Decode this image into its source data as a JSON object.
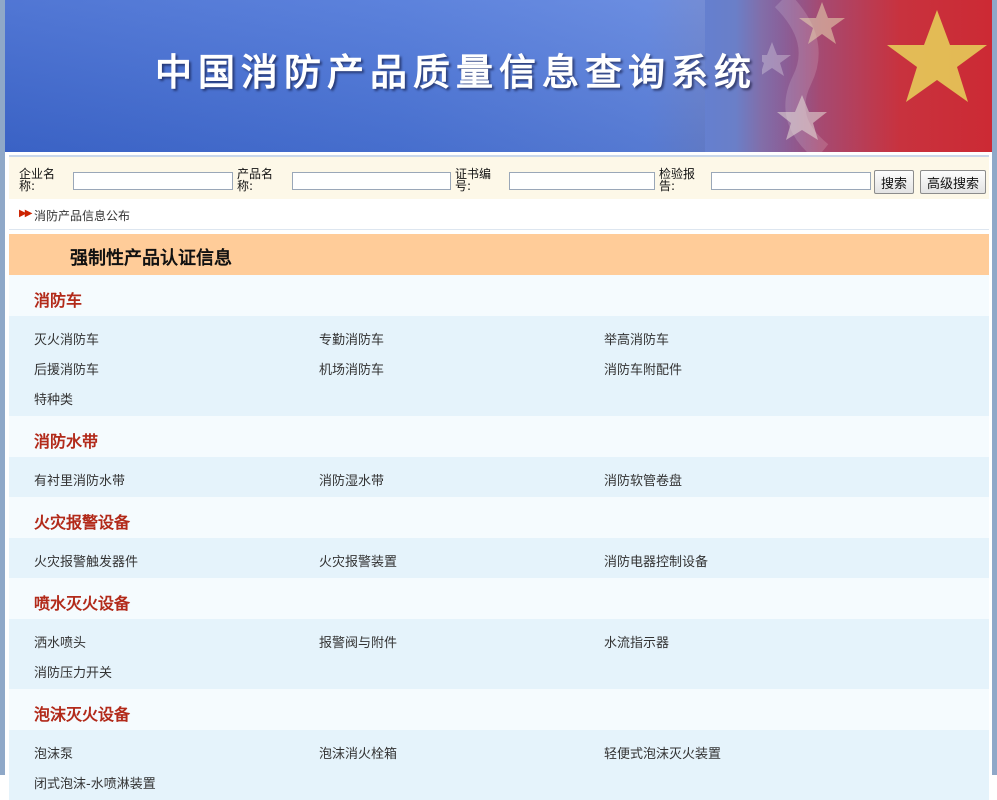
{
  "banner": {
    "title": "中国消防产品质量信息查询系统"
  },
  "search": {
    "company_label": "企业名称:",
    "product_label": "产品名称:",
    "cert_label": "证书编号:",
    "report_label": "检验报告:",
    "company_value": "",
    "product_value": "",
    "cert_value": "",
    "report_value": "",
    "search_button": "搜索",
    "advanced_button": "高级搜索"
  },
  "breadcrumb": {
    "text": "消防产品信息公布"
  },
  "section": {
    "title": "强制性产品认证信息"
  },
  "categories": [
    {
      "title": "消防车",
      "items": [
        "灭火消防车",
        "专勤消防车",
        "举高消防车",
        "后援消防车",
        "机场消防车",
        "消防车附配件",
        "特种类"
      ]
    },
    {
      "title": "消防水带",
      "items": [
        "有衬里消防水带",
        "消防湿水带",
        "消防软管卷盘"
      ]
    },
    {
      "title": "火灾报警设备",
      "items": [
        "火灾报警触发器件",
        "火灾报警装置",
        "消防电器控制设备"
      ]
    },
    {
      "title": "喷水灭火设备",
      "items": [
        "洒水喷头",
        "报警阀与附件",
        "水流指示器",
        "消防压力开关"
      ]
    },
    {
      "title": "泡沫灭火设备",
      "items": [
        "泡沫泵",
        "泡沫消火栓箱",
        "轻便式泡沫灭火装置",
        "闭式泡沫-水喷淋装置"
      ]
    }
  ],
  "colors": {
    "banner_blue": "#4a74d8",
    "header_bg": "#ffcc99",
    "category_red": "#b22a1a",
    "row_bg": "#e5f3fb"
  }
}
